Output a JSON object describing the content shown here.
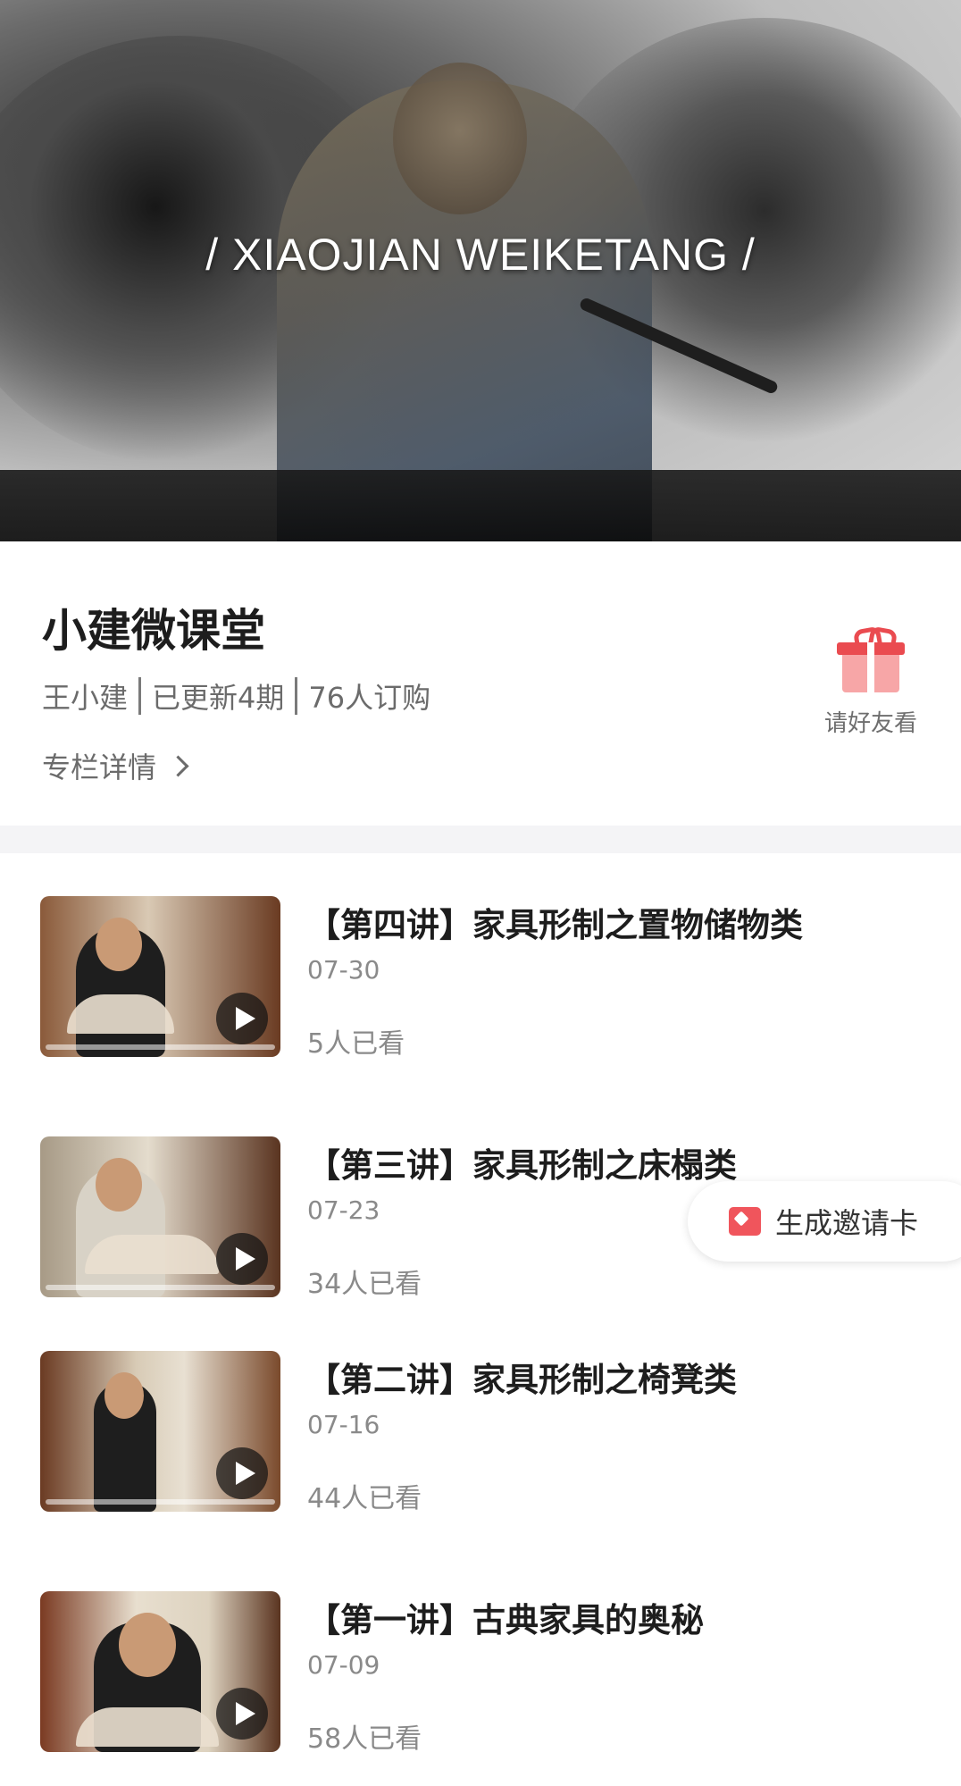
{
  "banner": {
    "title": "/ XIAOJIAN WEIKETANG /"
  },
  "column": {
    "title": "小建微课堂",
    "author": "王小建",
    "updated": "已更新4期",
    "subscribers": "76人订购",
    "detail_label": "专栏详情",
    "share_label": "请好友看"
  },
  "lessons": [
    {
      "title": "【第四讲】家具形制之置物储物类",
      "date": "07-30",
      "views": "5人已看"
    },
    {
      "title": "【第三讲】家具形制之床榻类",
      "date": "07-23",
      "views": "34人已看"
    },
    {
      "title": "【第二讲】家具形制之椅凳类",
      "date": "07-16",
      "views": "44人已看"
    },
    {
      "title": "【第一讲】古典家具的奥秘",
      "date": "07-09",
      "views": "58人已看"
    }
  ],
  "invite": {
    "label": "生成邀请卡"
  },
  "colors": {
    "accent": "#ea4b50",
    "text": "#1d1d1d",
    "muted": "#8a8a8a"
  },
  "icons": [
    "gift-icon",
    "chevron-right-icon",
    "play-icon",
    "invite-card-icon"
  ]
}
